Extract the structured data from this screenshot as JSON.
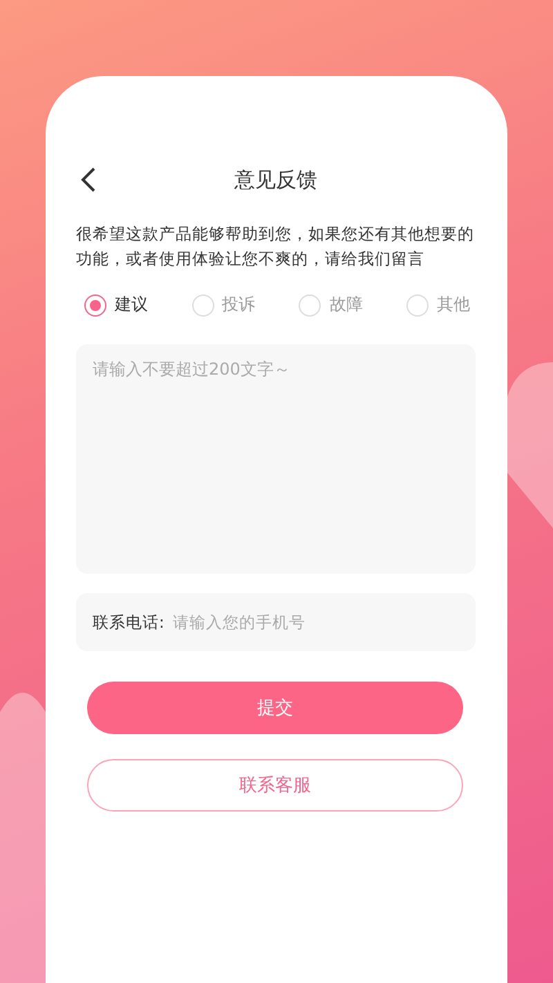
{
  "header": {
    "title": "意见反馈"
  },
  "intro": "很希望这款产品能够帮助到您，如果您还有其他想要的功能，或者使用体验让您不爽的，请给我们留言",
  "types": [
    {
      "label": "建议",
      "selected": true
    },
    {
      "label": "投诉",
      "selected": false
    },
    {
      "label": "故障",
      "selected": false
    },
    {
      "label": "其他",
      "selected": false
    }
  ],
  "feedback": {
    "placeholder": "请输入不要超过200文字～"
  },
  "phone": {
    "label": "联系电话:",
    "placeholder": "请输入您的手机号"
  },
  "buttons": [
    {
      "label": "提交",
      "kind": "primary"
    },
    {
      "label": "联系客服",
      "kind": "outline"
    }
  ]
}
